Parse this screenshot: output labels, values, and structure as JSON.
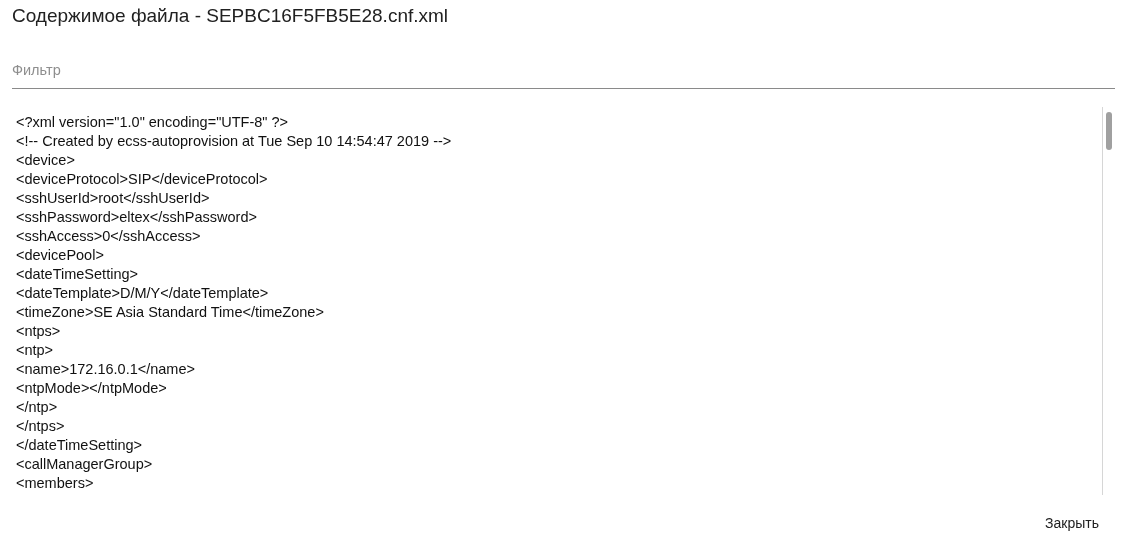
{
  "dialog": {
    "title": "Содержимое файла - SEPBC16F5FB5E28.cnf.xml"
  },
  "filter": {
    "placeholder": "Фильтр"
  },
  "content": {
    "lines": [
      "<?xml version=\"1.0\" encoding=\"UTF-8\" ?>",
      "<!-- Created by ecss-autoprovision at Tue Sep 10 14:54:47 2019 -->",
      "<device>",
      "<deviceProtocol>SIP</deviceProtocol>",
      "<sshUserId>root</sshUserId>",
      "<sshPassword>eltex</sshPassword>",
      "<sshAccess>0</sshAccess>",
      "<devicePool>",
      "<dateTimeSetting>",
      "<dateTemplate>D/M/Y</dateTemplate>",
      "<timeZone>SE Asia Standard Time</timeZone>",
      "<ntps>",
      "<ntp>",
      "<name>172.16.0.1</name>",
      "<ntpMode></ntpMode>",
      "</ntp>",
      "</ntps>",
      "</dateTimeSetting>",
      "<callManagerGroup>",
      "<members>"
    ]
  },
  "buttons": [
    {
      "label": "Закрыть"
    }
  ]
}
